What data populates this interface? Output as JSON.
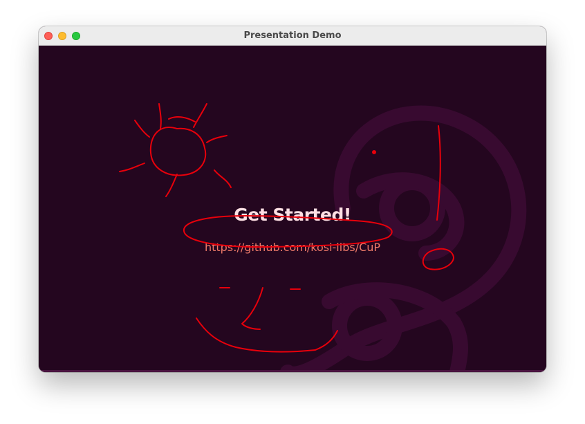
{
  "window": {
    "title": "Presentation Demo"
  },
  "slide": {
    "heading": "Get Started!",
    "link": "https://github.com/kosi-libs/CuP"
  },
  "colors": {
    "background": "#24061f",
    "decoration": "#380a30",
    "heading": "#ffe0e4",
    "link": "#f07b6a",
    "ink": "#e8000b"
  }
}
